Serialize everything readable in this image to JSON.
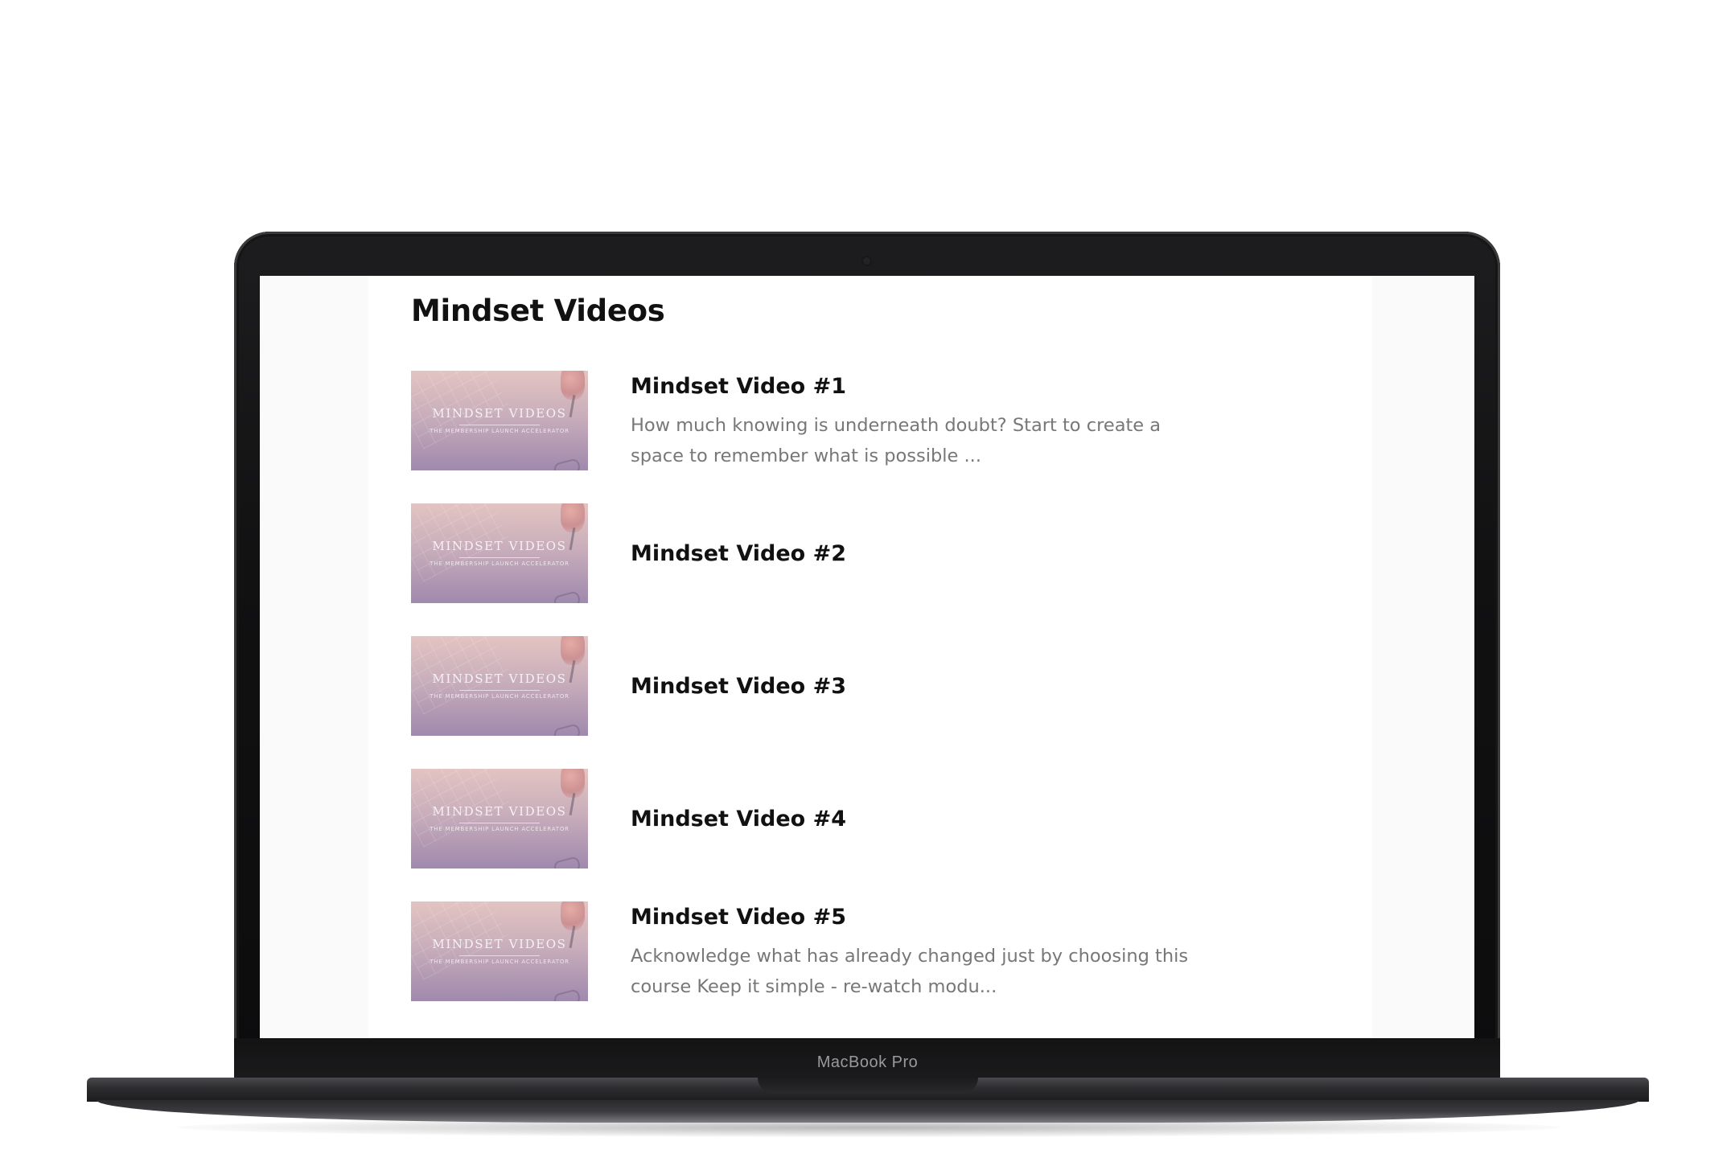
{
  "device": {
    "label": "MacBook Pro"
  },
  "page": {
    "title": "Mindset Videos",
    "thumbnail": {
      "title": "MINDSET VIDEOS",
      "subtitle": "THE MEMBERSHIP LAUNCH ACCELERATOR"
    },
    "videos": [
      {
        "title": "Mindset Video #1",
        "description": "How much knowing is underneath doubt?  Start to create a space to remember what is possible ..."
      },
      {
        "title": "Mindset Video #2",
        "description": ""
      },
      {
        "title": "Mindset Video #3",
        "description": ""
      },
      {
        "title": "Mindset Video #4",
        "description": ""
      },
      {
        "title": "Mindset Video #5",
        "description": "Acknowledge what has already changed just by choosing this course Keep it simple - re-watch modu..."
      }
    ]
  },
  "colors": {
    "title_text": "#111111",
    "description_text": "#777777",
    "bezel": "#111112",
    "page_background": "#ffffff",
    "side_background": "#fafafa"
  }
}
